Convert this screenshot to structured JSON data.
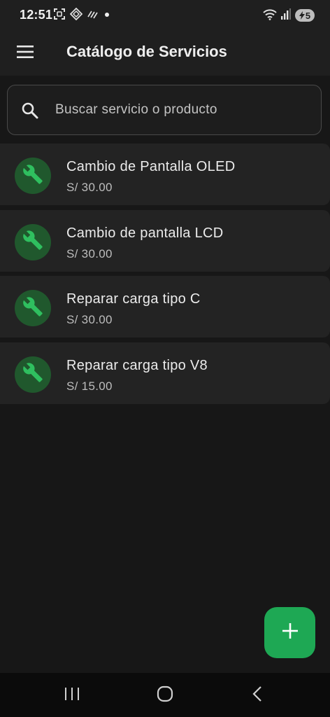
{
  "status_bar": {
    "time": "12:51",
    "battery_level": "5",
    "icons": [
      "screenshot-icon",
      "vpn-icon",
      "nfc-icon",
      "notification-dot-icon",
      "wifi-icon",
      "signal-icon",
      "battery-charging-icon"
    ]
  },
  "app_bar": {
    "menu_icon": "hamburger-menu-icon",
    "title": "Catálogo de Servicios"
  },
  "search": {
    "icon": "search-icon",
    "placeholder": "Buscar servicio o producto"
  },
  "services": [
    {
      "icon": "wrench-icon",
      "name": "Cambio de Pantalla OLED",
      "price": "S/ 30.00"
    },
    {
      "icon": "wrench-icon",
      "name": "Cambio de pantalla LCD",
      "price": "S/ 30.00"
    },
    {
      "icon": "wrench-icon",
      "name": "Reparar carga tipo C",
      "price": "S/ 30.00"
    },
    {
      "icon": "wrench-icon",
      "name": "Reparar carga tipo V8",
      "price": "S/ 15.00"
    }
  ],
  "fab": {
    "icon": "plus-icon"
  },
  "nav_bar": {
    "buttons": [
      "recent-apps-icon",
      "home-icon",
      "back-icon"
    ]
  },
  "colors": {
    "background": "#171717",
    "card": "#232323",
    "accent": "#1ea854",
    "avatar_bg": "#20582d",
    "wrench": "#2fbf5f"
  }
}
